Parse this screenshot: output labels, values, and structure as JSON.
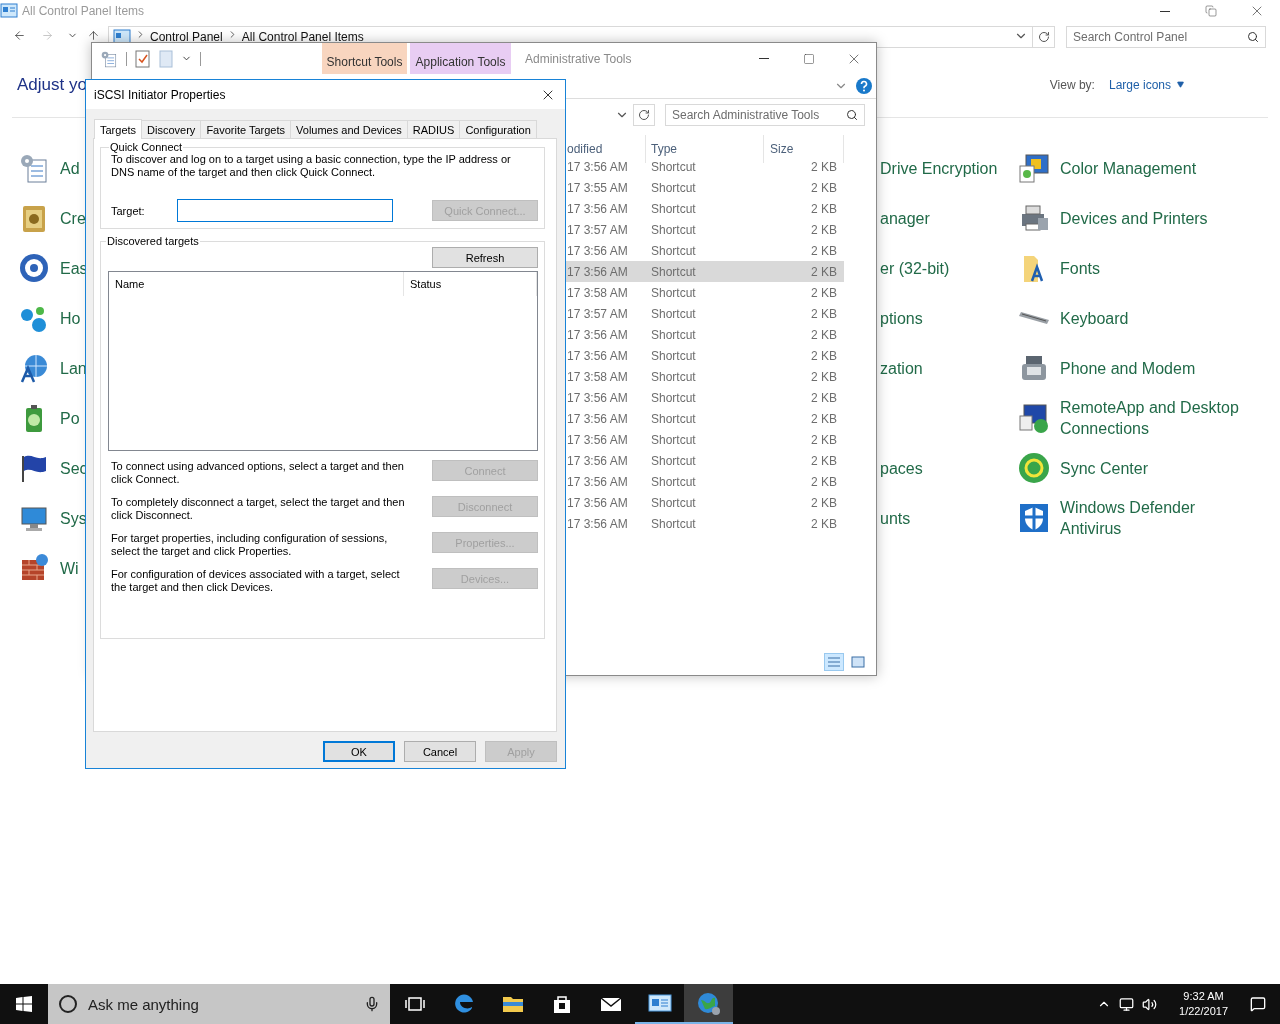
{
  "control_panel": {
    "title": "All Control Panel Items",
    "breadcrumb": [
      "Control Panel",
      "All Control Panel Items"
    ],
    "search": {
      "placeholder": "Search Control Panel"
    },
    "heading": "Adjust yo",
    "view_by": {
      "label": "View by:",
      "value": "Large icons"
    },
    "rows": [
      {
        "left": "Ad",
        "middle": "Drive Encryption",
        "right": "Color Management"
      },
      {
        "left": "Cre",
        "middle": "anager",
        "right": "Devices and Printers"
      },
      {
        "left": "Eas",
        "middle": "er (32-bit)",
        "right": "Fonts"
      },
      {
        "left": "Ho",
        "middle": "ptions",
        "right": "Keyboard"
      },
      {
        "left": "Lan",
        "middle": "zation",
        "right": "Phone and Modem"
      },
      {
        "left": "Po",
        "right": "RemoteApp and Desktop Connections"
      },
      {
        "left": "Sec",
        "middle": "paces",
        "right": "Sync Center"
      },
      {
        "left": "Sys",
        "middle": "unts",
        "right": "Windows Defender Antivirus"
      },
      {
        "left": "Wi"
      }
    ]
  },
  "admin_window": {
    "ribbon_tabs": [
      {
        "label": "Shortcut Tools",
        "kind": "shortcut"
      },
      {
        "label": "Application Tools",
        "kind": "application"
      }
    ],
    "title": "Administrative Tools",
    "search": {
      "placeholder": "Search Administrative Tools"
    },
    "columns": [
      "odified",
      "Type",
      "Size"
    ],
    "files": [
      {
        "modified": "17 3:56 AM",
        "type": "Shortcut",
        "size": "2 KB",
        "selected": false
      },
      {
        "modified": "17 3:55 AM",
        "type": "Shortcut",
        "size": "2 KB",
        "selected": false
      },
      {
        "modified": "17 3:56 AM",
        "type": "Shortcut",
        "size": "2 KB",
        "selected": false
      },
      {
        "modified": "17 3:57 AM",
        "type": "Shortcut",
        "size": "2 KB",
        "selected": false
      },
      {
        "modified": "17 3:56 AM",
        "type": "Shortcut",
        "size": "2 KB",
        "selected": false
      },
      {
        "modified": "17 3:56 AM",
        "type": "Shortcut",
        "size": "2 KB",
        "selected": true
      },
      {
        "modified": "17 3:58 AM",
        "type": "Shortcut",
        "size": "2 KB",
        "selected": false
      },
      {
        "modified": "17 3:57 AM",
        "type": "Shortcut",
        "size": "2 KB",
        "selected": false
      },
      {
        "modified": "17 3:56 AM",
        "type": "Shortcut",
        "size": "2 KB",
        "selected": false
      },
      {
        "modified": "17 3:56 AM",
        "type": "Shortcut",
        "size": "2 KB",
        "selected": false
      },
      {
        "modified": "17 3:58 AM",
        "type": "Shortcut",
        "size": "2 KB",
        "selected": false
      },
      {
        "modified": "17 3:56 AM",
        "type": "Shortcut",
        "size": "2 KB",
        "selected": false
      },
      {
        "modified": "17 3:56 AM",
        "type": "Shortcut",
        "size": "2 KB",
        "selected": false
      },
      {
        "modified": "17 3:56 AM",
        "type": "Shortcut",
        "size": "2 KB",
        "selected": false
      },
      {
        "modified": "17 3:56 AM",
        "type": "Shortcut",
        "size": "2 KB",
        "selected": false
      },
      {
        "modified": "17 3:56 AM",
        "type": "Shortcut",
        "size": "2 KB",
        "selected": false
      },
      {
        "modified": "17 3:56 AM",
        "type": "Shortcut",
        "size": "2 KB",
        "selected": false
      },
      {
        "modified": "17 3:56 AM",
        "type": "Shortcut",
        "size": "2 KB",
        "selected": false
      }
    ]
  },
  "dialog": {
    "title": "iSCSI Initiator Properties",
    "tabs": [
      {
        "label": "Targets",
        "selected": true
      },
      {
        "label": "Discovery",
        "selected": false
      },
      {
        "label": "Favorite Targets",
        "selected": false
      },
      {
        "label": "Volumes and Devices",
        "selected": false
      },
      {
        "label": "RADIUS",
        "selected": false
      },
      {
        "label": "Configuration",
        "selected": false
      }
    ],
    "quick_connect": {
      "legend": "Quick Connect",
      "description": "To discover and log on to a target using a basic connection, type the IP address or DNS name of the target and then click Quick Connect.",
      "target_label": "Target:",
      "button": {
        "label": "Quick Connect...",
        "disabled": true
      }
    },
    "discovered": {
      "legend": "Discovered targets",
      "refresh": {
        "label": "Refresh",
        "disabled": false
      },
      "columns": [
        "Name",
        "Status"
      ],
      "actions": [
        {
          "text": "To connect using advanced options, select a target and then click Connect.",
          "button": {
            "label": "Connect",
            "disabled": true
          }
        },
        {
          "text": "To completely disconnect a target, select the target and then click Disconnect.",
          "button": {
            "label": "Disconnect",
            "disabled": true
          }
        },
        {
          "text": "For target properties, including configuration of sessions, select the target and click Properties.",
          "button": {
            "label": "Properties...",
            "disabled": true
          }
        },
        {
          "text": "For configuration of devices associated with a target, select the target and then click Devices.",
          "button": {
            "label": "Devices...",
            "disabled": true
          }
        }
      ]
    },
    "buttons": [
      {
        "label": "OK",
        "disabled": false,
        "default": true
      },
      {
        "label": "Cancel",
        "disabled": false,
        "default": false
      },
      {
        "label": "Apply",
        "disabled": true,
        "default": false
      }
    ]
  },
  "taskbar": {
    "search": {
      "placeholder": "Ask me anything"
    },
    "apps": [
      {
        "kind": "task-view",
        "running": false,
        "focused": false
      },
      {
        "kind": "edge",
        "running": false,
        "focused": false
      },
      {
        "kind": "explorer",
        "running": false,
        "focused": false
      },
      {
        "kind": "store",
        "running": false,
        "focused": false
      },
      {
        "kind": "mail",
        "running": false,
        "focused": false
      },
      {
        "kind": "control-panel",
        "running": true,
        "focused": false
      },
      {
        "kind": "globe",
        "running": true,
        "focused": true
      }
    ],
    "time": "9:32 AM",
    "date": "1/22/2017"
  }
}
